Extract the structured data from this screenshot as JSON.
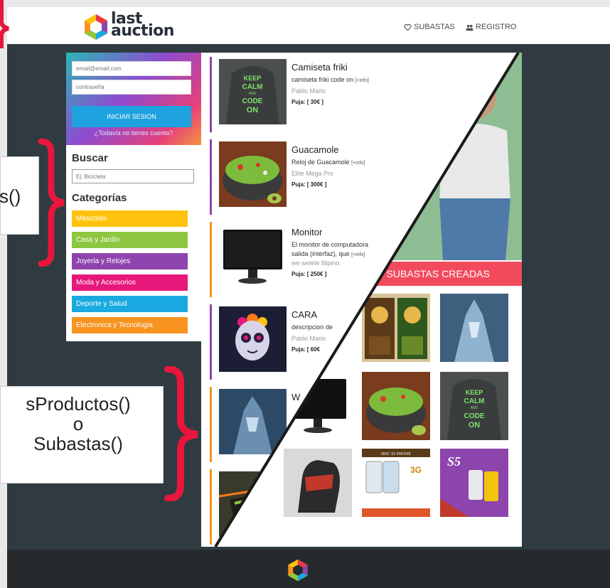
{
  "site": {
    "logo_line1": "last",
    "logo_line2": "auction",
    "nav": {
      "subastas": "SUBASTAS",
      "registro": "REGISTRO"
    },
    "colors": {
      "dark_bg": "#2f3b41",
      "accent_red": "#f24a5d",
      "footer": "#262a2d"
    }
  },
  "sidebar": {
    "email_placeholder": "email@email.com",
    "password_placeholder": "contraseña",
    "login_button": "INICIAR SESION",
    "register_link": "¿Todavía no tienes cuenta?",
    "search_heading": "Buscar",
    "search_placeholder": "Ej: Bicicleta",
    "categories_heading": "Categorías",
    "categories": [
      {
        "label": "Mascotas",
        "color": "#ffc20e"
      },
      {
        "label": "Casa y Jardin",
        "color": "#8dc63f"
      },
      {
        "label": "Joyeria y Relojes",
        "color": "#8e44ad"
      },
      {
        "label": "Moda y Accesorios",
        "color": "#e6197a"
      },
      {
        "label": "Deporte y Salud",
        "color": "#1aa9e0"
      },
      {
        "label": "Electronica y Tecnologia",
        "color": "#f7931e"
      }
    ]
  },
  "products": [
    {
      "title": "Camiseta friki",
      "desc": "camiseta friki code on",
      "more": "[+info]",
      "seller": "Pablo Mario",
      "bid": "Puja: [ 30€ ]",
      "image": "keep-calm-code-on-hoodie"
    },
    {
      "title": "Guacamole",
      "desc": "Reloj de Guacamole",
      "more": "[+info]",
      "seller": "Elite Mega Pro",
      "bid": "Puja: [ 300€ ]",
      "image": "guacamole-bowl"
    },
    {
      "title": "Monitor",
      "desc": "El monitor de computadora",
      "desc2": "salida (interfaz), que",
      "more": "[+info]",
      "seller": "we welele filipino",
      "bid": "Puja: [ 250€ ]",
      "image": "computer-monitor"
    },
    {
      "title": "CARA",
      "desc": "descripcion de",
      "seller": "Pablo Mario",
      "bid": "Puja: [ 60€",
      "image": "skull-face-art"
    },
    {
      "title": "W",
      "image": "ice-warrior"
    },
    {
      "image": "bike-bag"
    }
  ],
  "auctions": {
    "banner": "AS SUBASTAS CREADAS",
    "grid": [
      "warcraft-game-box",
      "ice-warrior",
      "guacamole-bowl",
      "keep-calm-code-on-hoodie",
      "computer-monitor",
      "bike-bag",
      "glove",
      "galaxy-s5-ad",
      "s5-promo"
    ],
    "s5_text": "S5",
    "s5_header": "HDC S5 PHONE",
    "s5_sub": "3G"
  },
  "annotations": {
    "left_label_1": "s()",
    "left_label_2": [
      "sProductos()",
      "o",
      "Subastas()"
    ],
    "brace_color": "#e8163c"
  }
}
